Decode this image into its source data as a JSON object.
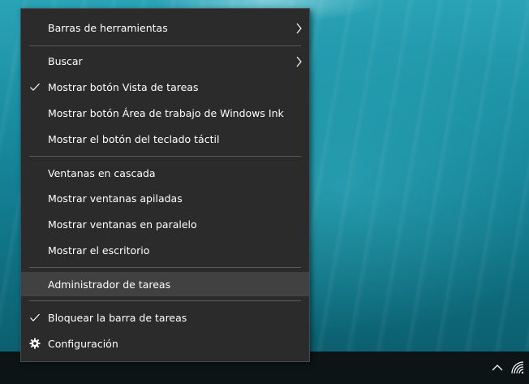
{
  "menu": {
    "toolbars": "Barras de herramientas",
    "search": "Buscar",
    "show_task_view": "Mostrar botón Vista de tareas",
    "show_ink": "Mostrar botón Área de trabajo de Windows Ink",
    "show_keyboard": "Mostrar el botón del teclado táctil",
    "cascade": "Ventanas en cascada",
    "stacked": "Mostrar ventanas apiladas",
    "side_by_side": "Mostrar ventanas en paralelo",
    "desktop": "Mostrar el escritorio",
    "task_manager": "Administrador de tareas",
    "lock_taskbar": "Bloquear la barra de tareas",
    "settings": "Configuración"
  },
  "state": {
    "show_task_view_checked": true,
    "lock_taskbar_checked": true,
    "hovered_item": "Administrador de tareas"
  },
  "icons": {
    "submenu": "chevron-right-icon",
    "checked": "checkmark-icon",
    "settings": "gear-icon",
    "tray_overflow": "chevron-up-icon",
    "network": "wifi-icon"
  },
  "colors": {
    "menu_bg": "#2b2b2b",
    "hover_bg": "#414141",
    "text": "#ffffff",
    "taskbar": "#0d1416"
  }
}
